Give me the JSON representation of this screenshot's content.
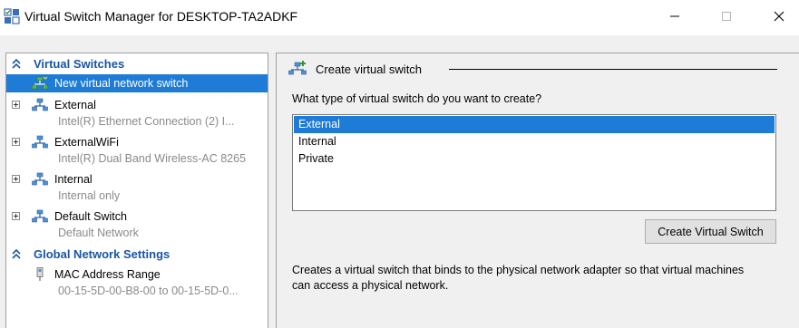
{
  "window": {
    "title": "Virtual Switch Manager for DESKTOP-TA2ADKF",
    "controls": [
      "minimize",
      "maximize",
      "close"
    ]
  },
  "left_panel": {
    "sections": [
      {
        "header": "Virtual Switches",
        "items": [
          {
            "label": "New virtual network switch",
            "selected": true,
            "expandable": false
          },
          {
            "label": "External",
            "sub": "Intel(R) Ethernet Connection (2) I...",
            "expandable": true
          },
          {
            "label": "ExternalWiFi",
            "sub": "Intel(R) Dual Band Wireless-AC 8265",
            "expandable": true
          },
          {
            "label": "Internal",
            "sub": "Internal only",
            "expandable": true
          },
          {
            "label": "Default Switch",
            "sub": "Default Network",
            "expandable": true
          }
        ]
      },
      {
        "header": "Global Network Settings",
        "items": [
          {
            "label": "MAC Address Range",
            "sub": "00-15-5D-00-B8-00 to 00-15-5D-0..."
          }
        ]
      }
    ]
  },
  "right_panel": {
    "header": "Create virtual switch",
    "question": "What type of virtual switch do you want to create?",
    "switch_types": [
      {
        "label": "External",
        "selected": true
      },
      {
        "label": "Internal",
        "selected": false
      },
      {
        "label": "Private",
        "selected": false
      }
    ],
    "create_button": "Create Virtual Switch",
    "description": "Creates a virtual switch that binds to the physical network adapter so that virtual machines can access a physical network."
  },
  "colors": {
    "selection": "#1e7bd6",
    "section_header": "#1a55a5",
    "sub_text": "#8a8a8a"
  }
}
